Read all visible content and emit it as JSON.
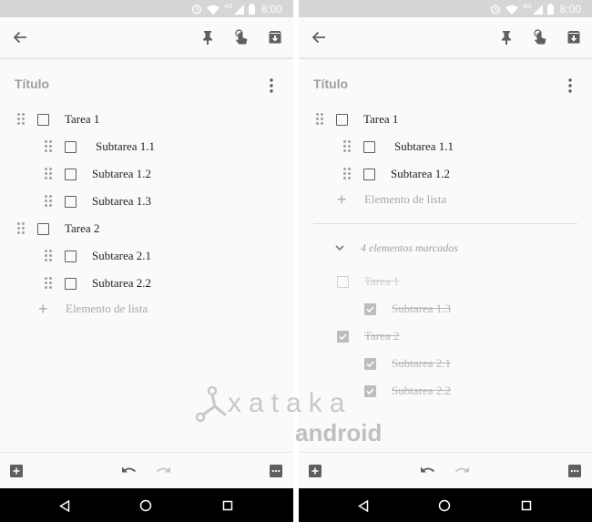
{
  "status": {
    "time": "8:00",
    "network": "4G"
  },
  "note": {
    "title": "Título",
    "add_item_label": "Elemento de lista"
  },
  "left": {
    "items": [
      {
        "label": "Tarea 1",
        "checked": false
      },
      {
        "label": "Subtarea 1.1",
        "checked": false
      },
      {
        "label": "Subtarea 1.2",
        "checked": false
      },
      {
        "label": "Subtarea 1.3",
        "checked": false
      },
      {
        "label": "Tarea 2",
        "checked": false
      },
      {
        "label": "Subtarea 2.1",
        "checked": false
      },
      {
        "label": "Subtarea 2.2",
        "checked": false
      }
    ]
  },
  "right": {
    "items": [
      {
        "label": "Tarea 1",
        "checked": false
      },
      {
        "label": "Subtarea 1.1",
        "checked": false
      },
      {
        "label": "Subtarea 1.2",
        "checked": false
      }
    ],
    "checked_header": "4 elementos marcados",
    "checked_items": [
      {
        "label": "Tarea 1",
        "checked": false
      },
      {
        "label": "Subtarea 1.3",
        "checked": true
      },
      {
        "label": "Tarea 2",
        "checked": true
      },
      {
        "label": "Subtarea 2.1",
        "checked": true
      },
      {
        "label": "Subtarea 2.2",
        "checked": true
      }
    ]
  },
  "watermark": {
    "top": "xataka",
    "bottom": "android"
  },
  "icons": {
    "back": "arrow-left-icon",
    "pin": "pin-icon",
    "reminder": "hand-touch-icon",
    "archive": "archive-icon",
    "more": "more-vert-icon",
    "add_box": "add-box-icon",
    "undo": "undo-icon",
    "redo": "redo-icon",
    "overflow": "more-horiz-box-icon"
  },
  "colors": {
    "status_bar": "#d6d6d6",
    "background": "#fafafa",
    "nav_bar": "#000000",
    "icon": "#5f5f5f"
  }
}
